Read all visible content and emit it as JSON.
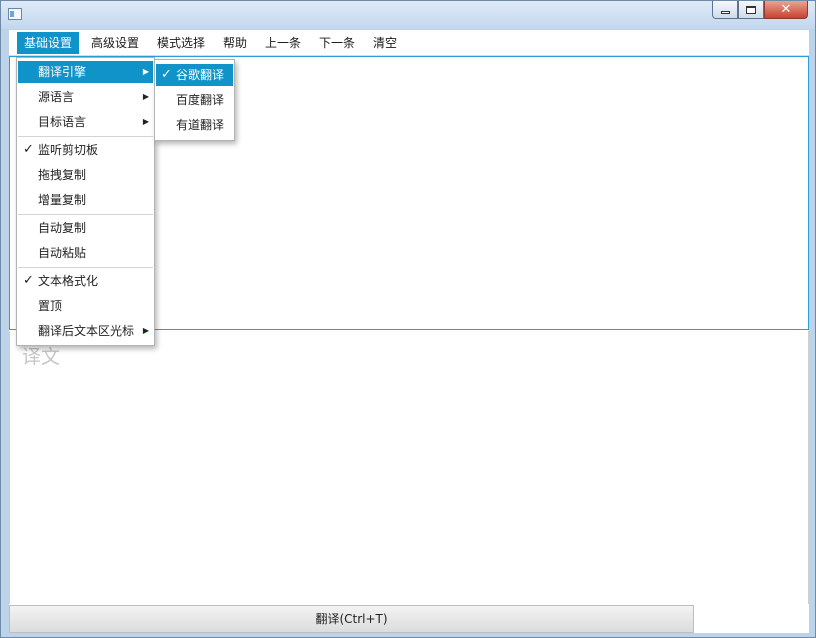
{
  "window": {
    "controls": {
      "minimize_icon": "minimize-icon",
      "maximize_icon": "maximize-icon",
      "close_icon": "close-icon"
    }
  },
  "menubar": {
    "items": [
      {
        "label": "基础设置",
        "active": true
      },
      {
        "label": "高级设置"
      },
      {
        "label": "模式选择"
      },
      {
        "label": "帮助"
      },
      {
        "label": "上一条"
      },
      {
        "label": "下一条"
      },
      {
        "label": "清空"
      }
    ]
  },
  "basic_menu": {
    "items": [
      {
        "label": "翻译引擎",
        "submenu": true,
        "highlighted": true
      },
      {
        "label": "源语言",
        "submenu": true
      },
      {
        "label": "目标语言",
        "submenu": true
      },
      {
        "label": "监听剪切板",
        "checked": true
      },
      {
        "label": "拖拽复制"
      },
      {
        "label": "增量复制"
      },
      {
        "label": "自动复制"
      },
      {
        "label": "自动粘贴"
      },
      {
        "label": "文本格式化",
        "checked": true
      },
      {
        "label": "置顶"
      },
      {
        "label": "翻译后文本区光标",
        "submenu": true
      }
    ]
  },
  "engine_submenu": {
    "items": [
      {
        "label": "谷歌翻译",
        "checked": true,
        "highlighted": true
      },
      {
        "label": "百度翻译"
      },
      {
        "label": "有道翻译"
      }
    ]
  },
  "check_glyph": "✓",
  "submenu_arrow_glyph": "▶",
  "target_area": {
    "placeholder": "译文"
  },
  "translate_button": {
    "label": "翻译(Ctrl+T)"
  },
  "colors": {
    "accent": "#0f93c9",
    "focus_border": "#2a9fd6",
    "frame": "#bcd3ea"
  }
}
